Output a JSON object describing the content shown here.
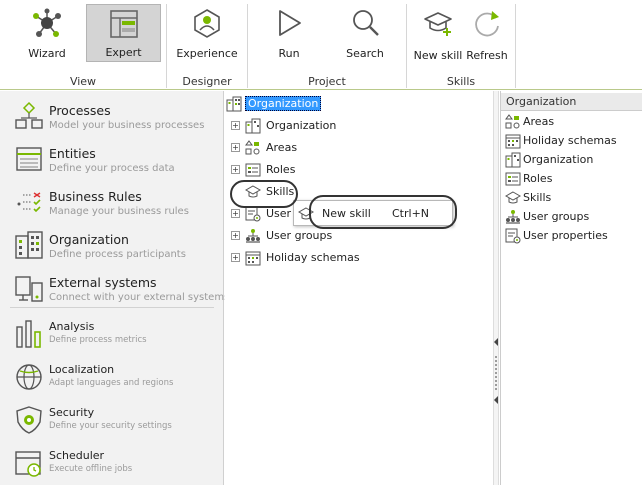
{
  "ribbon": {
    "groups": [
      {
        "label": "View"
      },
      {
        "label": "Designer"
      },
      {
        "label": "Project"
      },
      {
        "label": "Skills"
      }
    ],
    "buttons": [
      {
        "label": "Wizard",
        "icon": "wizard-icon",
        "active": false
      },
      {
        "label": "Expert",
        "icon": "expert-icon",
        "active": true
      },
      {
        "label": "Experience",
        "icon": "experience-icon",
        "active": false
      },
      {
        "label": "Run",
        "icon": "run-icon",
        "active": false
      },
      {
        "label": "Search",
        "icon": "search-icon",
        "active": false
      },
      {
        "label": "New skill",
        "icon": "new-skill-icon",
        "active": false
      },
      {
        "label": "Refresh",
        "icon": "refresh-icon",
        "active": false
      }
    ]
  },
  "nav": {
    "items": [
      {
        "title": "Processes",
        "subtitle": "Model your business processes",
        "icon": "processes-icon"
      },
      {
        "title": "Entities",
        "subtitle": "Define your process data",
        "icon": "entities-icon"
      },
      {
        "title": "Business Rules",
        "subtitle": "Manage your business rules",
        "icon": "business-rules-icon"
      },
      {
        "title": "Organization",
        "subtitle": "Define process participants",
        "icon": "organization-icon"
      },
      {
        "title": "External systems",
        "subtitle": "Connect with your external systems",
        "icon": "external-systems-icon"
      },
      {
        "title": "Analysis",
        "subtitle": "Define process metrics",
        "icon": "analysis-icon"
      },
      {
        "title": "Localization",
        "subtitle": "Adapt languages and regions",
        "icon": "localization-icon"
      },
      {
        "title": "Security",
        "subtitle": "Define your security settings",
        "icon": "security-icon"
      },
      {
        "title": "Scheduler",
        "subtitle": "Execute offline jobs",
        "icon": "scheduler-icon"
      }
    ]
  },
  "tree": {
    "root": "Organization",
    "children": [
      {
        "label": "Organization",
        "icon": "organization-icon"
      },
      {
        "label": "Areas",
        "icon": "areas-icon"
      },
      {
        "label": "Roles",
        "icon": "roles-icon"
      },
      {
        "label": "Skills",
        "icon": "skills-icon"
      },
      {
        "label": "User",
        "icon": "user-properties-icon"
      },
      {
        "label": "User groups",
        "icon": "user-groups-icon"
      },
      {
        "label": "Holiday schemas",
        "icon": "holiday-schemas-icon"
      }
    ]
  },
  "context_menu": {
    "label": "New skill",
    "shortcut": "Ctrl+N",
    "icon": "new-skill-icon"
  },
  "right_panel": {
    "header": "Organization",
    "items": [
      {
        "label": "Areas",
        "icon": "areas-icon"
      },
      {
        "label": "Holiday schemas",
        "icon": "holiday-schemas-icon"
      },
      {
        "label": "Organization",
        "icon": "organization-icon"
      },
      {
        "label": "Roles",
        "icon": "roles-icon"
      },
      {
        "label": "Skills",
        "icon": "skills-icon"
      },
      {
        "label": "User groups",
        "icon": "user-groups-icon"
      },
      {
        "label": "User properties",
        "icon": "user-properties-icon"
      }
    ]
  },
  "colors": {
    "accent_green": "#7ab800",
    "selection_blue": "#3399ff",
    "ribbon_border": "#b9c98a",
    "nav_background": "#f2f2f2"
  }
}
